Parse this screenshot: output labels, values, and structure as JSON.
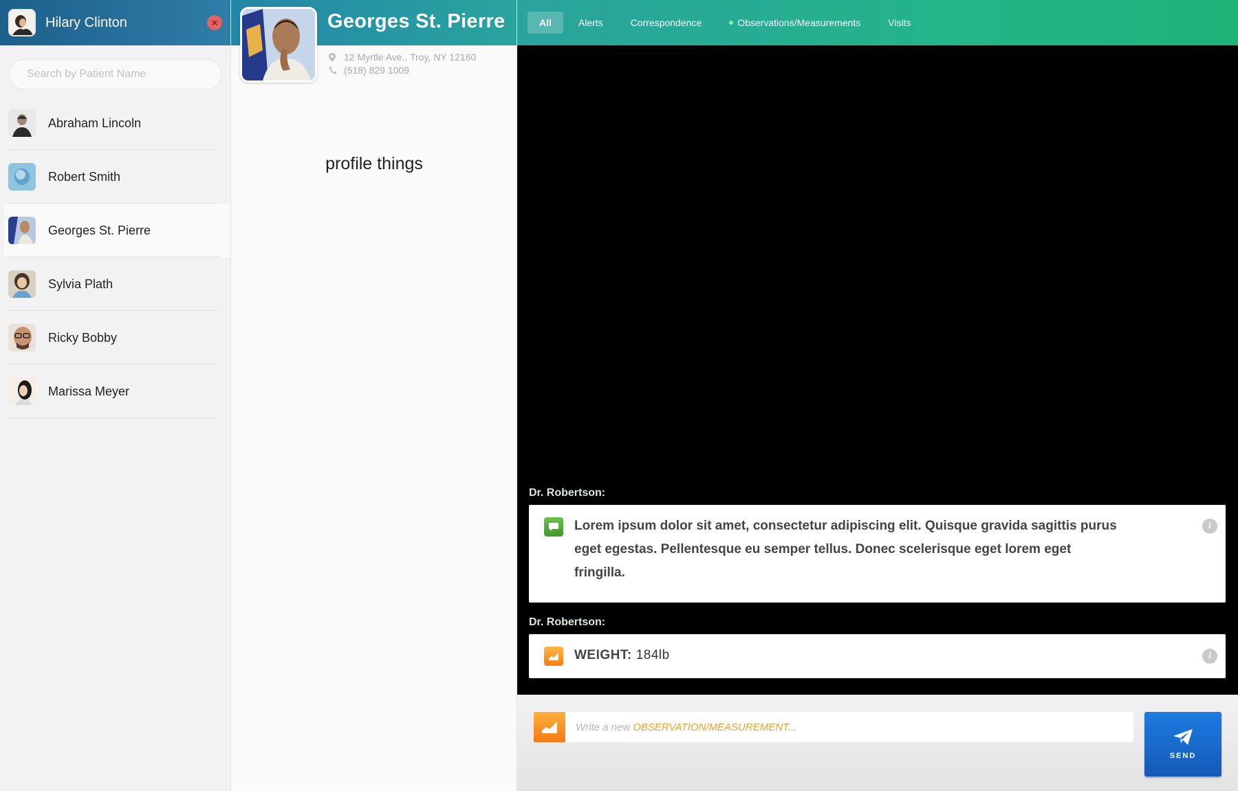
{
  "sidebar": {
    "user_name": "Hilary Clinton",
    "search_placeholder": "Search by Patient Name",
    "patients": [
      {
        "name": "Abraham Lincoln"
      },
      {
        "name": "Robert Smith"
      },
      {
        "name": "Georges St. Pierre",
        "active": true
      },
      {
        "name": "Sylvia Plath"
      },
      {
        "name": "Ricky Bobby"
      },
      {
        "name": "Marissa Meyer"
      }
    ]
  },
  "profile": {
    "name": "Georges St. Pierre",
    "address": "12 Myrtle Ave., Troy, NY 12180",
    "phone": "(518) 829 1009",
    "placeholder": "profile things"
  },
  "tabs": [
    {
      "label": "All",
      "active": true
    },
    {
      "label": "Alerts"
    },
    {
      "label": "Correspondence"
    },
    {
      "label": "Observations/Measurements",
      "dot": true
    },
    {
      "label": "Visits"
    }
  ],
  "feed": {
    "messages": [
      {
        "author": "Dr. Robertson:",
        "type": "correspondence",
        "text": "Lorem ipsum dolor sit amet, consectetur adipiscing elit. Quisque gravida sagittis purus eget egestas. Pellentesque eu semper tellus. Donec scelerisque eget lorem eget fringilla."
      },
      {
        "author": "Dr. Robertson:",
        "type": "observation",
        "label": "WEIGHT:",
        "value": "184lb"
      }
    ]
  },
  "composer": {
    "placeholder_prefix": "Write a new",
    "placeholder_type": "OBSERVATION/MEASUREMENT...",
    "send_label": "SEND"
  },
  "colors": {
    "sidebar_header": "#1d5f8c",
    "feed_header": "#24b489",
    "send_button": "#1e7be0",
    "observation_icon": "#f57c14",
    "correspondence_icon": "#3c9a2a"
  }
}
